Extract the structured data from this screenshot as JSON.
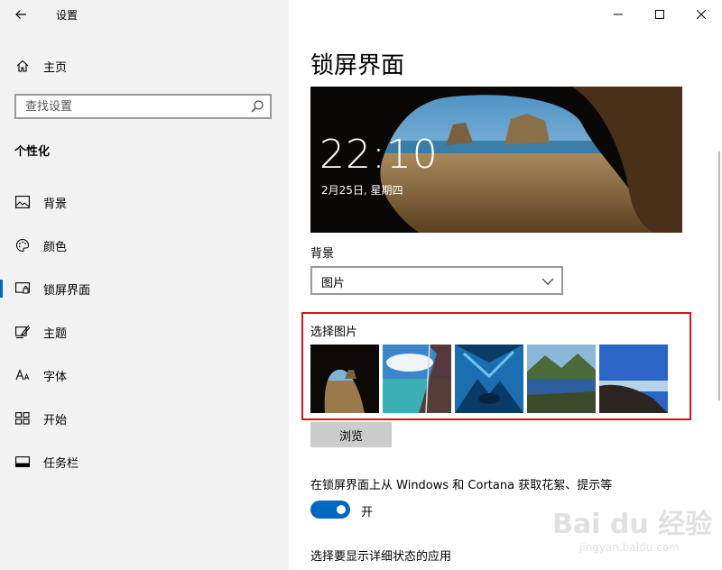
{
  "app": {
    "title": "设置",
    "back_icon": "back-arrow-icon"
  },
  "sidebar": {
    "home": {
      "label": "主页",
      "icon": "home-icon"
    },
    "search": {
      "placeholder": "查找设置",
      "icon": "search-icon"
    },
    "section_title": "个性化",
    "items": [
      {
        "label": "背景",
        "icon": "picture-icon"
      },
      {
        "label": "颜色",
        "icon": "palette-icon"
      },
      {
        "label": "锁屏界面",
        "icon": "lock-screen-icon",
        "active": true
      },
      {
        "label": "主题",
        "icon": "theme-brush-icon"
      },
      {
        "label": "字体",
        "icon": "font-icon"
      },
      {
        "label": "开始",
        "icon": "start-grid-icon"
      },
      {
        "label": "任务栏",
        "icon": "taskbar-icon"
      }
    ]
  },
  "window": {
    "controls": [
      "minimize-icon",
      "maximize-icon",
      "close-icon"
    ]
  },
  "main": {
    "title": "锁屏界面",
    "preview": {
      "time": "22:10",
      "date": "2月25日, 星期四"
    },
    "background_label": "背景",
    "background_value": "图片",
    "choose_picture_label": "选择图片",
    "browse_label": "浏览",
    "cortana_label": "在锁屏界面上从 Windows 和 Cortana 获取花絮、提示等",
    "toggle_state_label": "开",
    "detail_status_label": "选择要显示详细状态的应用"
  },
  "watermark": {
    "logo": "Bai du 经验",
    "sub": "jingyan.baidu.com"
  },
  "colors": {
    "accent": "#0067c0",
    "highlight": "#e0101b",
    "sidebar_bg": "#f2f2f2"
  }
}
